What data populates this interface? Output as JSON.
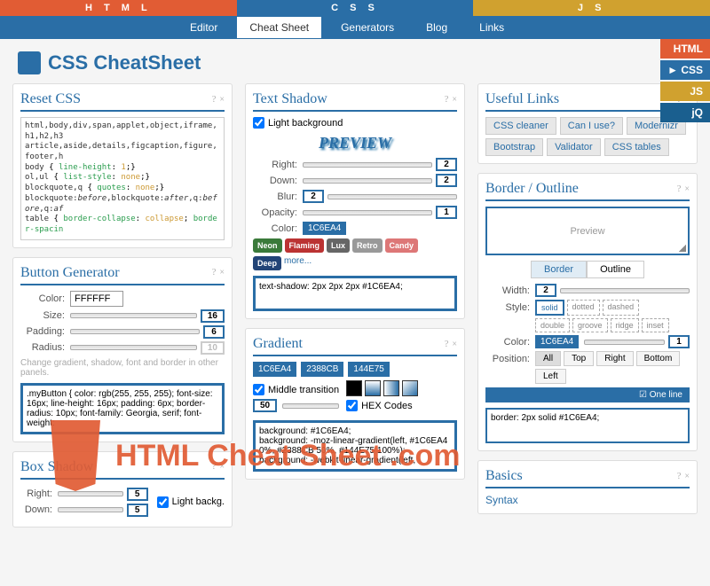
{
  "topTabs": {
    "html": "H T M L",
    "css": "C S S",
    "js": "J S"
  },
  "nav": {
    "editor": "Editor",
    "cheatsheet": "Cheat Sheet",
    "generators": "Generators",
    "blog": "Blog",
    "links": "Links"
  },
  "logo": "CSS CheatSheet",
  "sideTabs": {
    "html": "HTML",
    "css": "► CSS",
    "js": "JS",
    "jq": "jQ"
  },
  "panels": {
    "resetCss": {
      "title": "Reset CSS"
    },
    "buttonGen": {
      "title": "Button Generator",
      "labels": {
        "color": "Color:",
        "size": "Size:",
        "padding": "Padding:",
        "radius": "Radius:"
      },
      "color": "FFFFFF",
      "size": "16",
      "padding": "6",
      "radius": "10",
      "hint": "Change gradient, shadow, font and border in other panels."
    },
    "boxShadow": {
      "title": "Box Shadow",
      "labels": {
        "right": "Right:",
        "down": "Down:"
      },
      "right": "5",
      "down": "5",
      "lightBg": "Light backg."
    },
    "textShadow": {
      "title": "Text Shadow",
      "lightBg": "Light background",
      "preview": "PREVIEW",
      "labels": {
        "right": "Right:",
        "down": "Down:",
        "blur": "Blur:",
        "opacity": "Opacity:",
        "color": "Color:"
      },
      "right": "2",
      "down": "2",
      "blur": "2",
      "opacity": "1",
      "color": "1C6EA4",
      "more": "more...",
      "output": "text-shadow: 2px 2px 2px #1C6EA4;"
    },
    "gradient": {
      "title": "Gradient",
      "c1": "1C6EA4",
      "c2": "2388CB",
      "c3": "144E75",
      "middle": "Middle transition",
      "midVal": "50",
      "hex": "HEX Codes",
      "output": "background: #1C6EA4;\nbackground: -moz-linear-gradient(left, #1C6EA4 0%, #2388CB 50%, #144E75 100%);\nbackground: -webkit-linear-gradient(left,"
    },
    "usefulLinks": {
      "title": "Useful Links",
      "links": [
        "CSS cleaner",
        "Can I use?",
        "Modernizr",
        "Bootstrap",
        "Validator",
        "CSS tables"
      ]
    },
    "border": {
      "title": "Border / Outline",
      "preview": "Preview",
      "tabBorder": "Border",
      "tabOutline": "Outline",
      "labels": {
        "width": "Width:",
        "style": "Style:",
        "color": "Color:",
        "position": "Position:"
      },
      "width": "2",
      "styles": [
        "solid",
        "dotted",
        "dashed",
        "double",
        "groove",
        "ridge",
        "inset"
      ],
      "color": "1C6EA4",
      "colorOpacity": "1",
      "positions": [
        "All",
        "Top",
        "Right",
        "Bottom",
        "Left"
      ],
      "oneLine": "One line",
      "output": "border: 2px solid #1C6EA4;"
    },
    "basics": {
      "title": "Basics",
      "syntax": "Syntax"
    }
  },
  "resetCode": "html,body,div,span,applet,object,iframe,h1,h2,h3\narticle,aside,details,figcaption,figure,footer,h\nbody { line-height: 1;}\nol,ul { list-style: none;}\nblockquote,q { quotes: none;}\nblockquote:before,blockquote:after,q:before,q:af\ntable { border-collapse: collapse; border-spacin",
  "buttonOutput": ".myButton {\ncolor: rgb(255, 255, 255); font-size: 16px; line-height: 16px; padding: 6px; border-radius: 10px; font-family: Georgia, serif; font-weight:",
  "styleBtns": {
    "neon": "Neon",
    "flaming": "Flaming",
    "lux": "Lux",
    "retro": "Retro",
    "deep": "Deep",
    "candy": "Candy"
  },
  "watermark": "HTML Cheat Sheet .com"
}
